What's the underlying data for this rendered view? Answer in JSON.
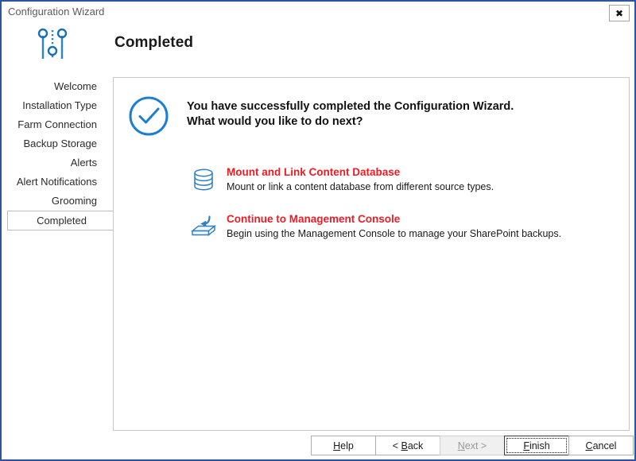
{
  "window": {
    "title": "Configuration Wizard",
    "close_label": "✖",
    "close_icon": "close-icon",
    "border_color": "#2b579a"
  },
  "header": {
    "icon": "wizard-sliders-icon",
    "heading": "Completed"
  },
  "sidebar": {
    "items": [
      {
        "label": "Welcome",
        "selected": false
      },
      {
        "label": "Installation Type",
        "selected": false
      },
      {
        "label": "Farm Connection",
        "selected": false
      },
      {
        "label": "Backup Storage",
        "selected": false
      },
      {
        "label": "Alerts",
        "selected": false
      },
      {
        "label": "Alert Notifications",
        "selected": false
      },
      {
        "label": "Grooming",
        "selected": false
      },
      {
        "label": "Completed",
        "selected": true
      }
    ]
  },
  "content": {
    "status_icon": "check-circle-icon",
    "success_line1": "You have successfully completed the Configuration Wizard.",
    "success_line2": "What would you like to do next?",
    "actions": [
      {
        "icon": "database-icon",
        "title": "Mount and Link Content Database",
        "description": "Mount or link a content database from different source types."
      },
      {
        "icon": "inbox-arrow-icon",
        "title": "Continue to Management Console",
        "description": "Begin using the Management Console to manage your SharePoint backups."
      }
    ],
    "accent_red": "#ed1c24",
    "accent_blue": "#0078d7"
  },
  "footer": {
    "buttons": [
      {
        "id": "help",
        "prefix": "",
        "accel": "H",
        "suffix": "elp",
        "state": "enabled"
      },
      {
        "id": "back",
        "prefix": "< ",
        "accel": "B",
        "suffix": "ack",
        "state": "enabled"
      },
      {
        "id": "next",
        "prefix": "",
        "accel": "N",
        "suffix": "ext >",
        "state": "disabled"
      },
      {
        "id": "finish",
        "prefix": "",
        "accel": "F",
        "suffix": "inish",
        "state": "default"
      },
      {
        "id": "cancel",
        "prefix": "",
        "accel": "C",
        "suffix": "ancel",
        "state": "enabled"
      }
    ]
  }
}
